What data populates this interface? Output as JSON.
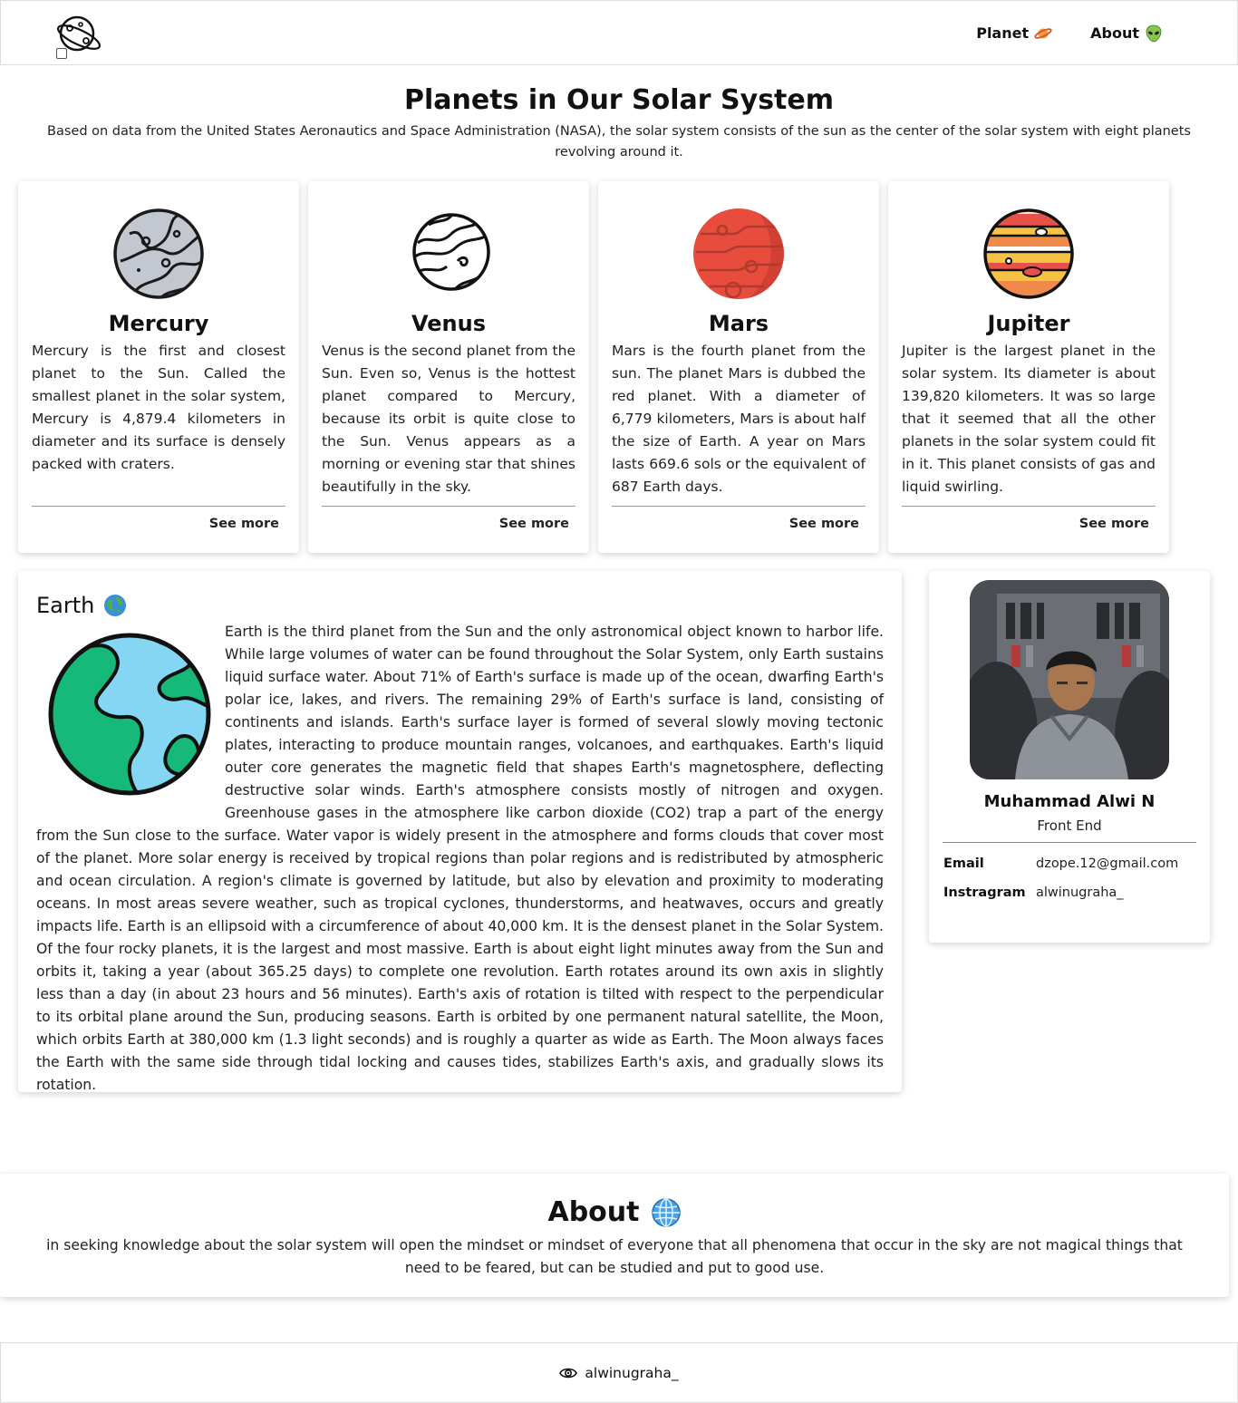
{
  "nav": {
    "logo_icon": "planet-logo-icon",
    "items": [
      {
        "label": "Planet",
        "icon": "saturn-icon"
      },
      {
        "label": "About",
        "icon": "alien-icon"
      }
    ]
  },
  "header": {
    "title": "Planets in Our Solar System",
    "subtitle": "Based on data from the United States Aeronautics and Space Administration (NASA), the solar system consists of the sun as the center of the solar system with eight planets revolving around it."
  },
  "planets": [
    {
      "name": "Mercury",
      "icon": "mercury-icon",
      "description": "Mercury is the first and closest planet to the Sun. Called the smallest planet in the solar system, Mercury is 4,879.4 kilometers in diameter and its surface is densely packed with craters.",
      "link": "See more"
    },
    {
      "name": "Venus",
      "icon": "venus-icon",
      "description": "Venus is the second planet from the Sun. Even so, Venus is the hottest planet compared to Mercury, because its orbit is quite close to the Sun. Venus appears as a morning or evening star that shines beautifully in the sky.",
      "link": "See more"
    },
    {
      "name": "Mars",
      "icon": "mars-icon",
      "description": "Mars is the fourth planet from the sun. The planet Mars is dubbed the red planet. With a diameter of 6,779 kilometers, Mars is about half the size of Earth. A year on Mars lasts 669.6 sols or the equivalent of 687 Earth days.",
      "link": "See more"
    },
    {
      "name": "Jupiter",
      "icon": "jupiter-icon",
      "description": "Jupiter is the largest planet in the solar system. Its diameter is about 139,820 kilometers. It was so large that it seemed that all the other planets in the solar system could fit in it. This planet consists of gas and liquid swirling.",
      "link": "See more"
    }
  ],
  "earth": {
    "title": "Earth",
    "title_icon": "globe-emoji-icon",
    "image_icon": "earth-icon",
    "text": "Earth is the third planet from the Sun and the only astronomical object known to harbor life. While large volumes of water can be found throughout the Solar System, only Earth sustains liquid surface water. About 71% of Earth's surface is made up of the ocean, dwarfing Earth's polar ice, lakes, and rivers. The remaining 29% of Earth's surface is land, consisting of continents and islands. Earth's surface layer is formed of several slowly moving tectonic plates, interacting to produce mountain ranges, volcanoes, and earthquakes. Earth's liquid outer core generates the magnetic field that shapes Earth's magnetosphere, deflecting destructive solar winds. Earth's atmosphere consists mostly of nitrogen and oxygen. Greenhouse gases in the atmosphere like carbon dioxide (CO2) trap a part of the energy from the Sun close to the surface. Water vapor is widely present in the atmosphere and forms clouds that cover most of the planet. More solar energy is received by tropical regions than polar regions and is redistributed by atmospheric and ocean circulation. A region's climate is governed by latitude, but also by elevation and proximity to moderating oceans. In most areas severe weather, such as tropical cyclones, thunderstorms, and heatwaves, occurs and greatly impacts life. Earth is an ellipsoid with a circumference of about 40,000 km. It is the densest planet in the Solar System. Of the four rocky planets, it is the largest and most massive. Earth is about eight light minutes away from the Sun and orbits it, taking a year (about 365.25 days) to complete one revolution. Earth rotates around its own axis in slightly less than a day (in about 23 hours and 56 minutes). Earth's axis of rotation is tilted with respect to the perpendicular to its orbital plane around the Sun, producing seasons. Earth is orbited by one permanent natural satellite, the Moon, which orbits Earth at 380,000 km (1.3 light seconds) and is roughly a quarter as wide as Earth. The Moon always faces the Earth with the same side through tidal locking and causes tides, stabilizes Earth's axis, and gradually slows its rotation."
  },
  "profile": {
    "photo": "profile-photo",
    "name": "Muhammad Alwi N",
    "role": "Front End",
    "email_label": "Email",
    "email": "dzope.12@gmail.com",
    "instagram_label": "Instragram",
    "instagram": "alwinugraha_"
  },
  "about": {
    "title": "About",
    "title_icon": "globe-meridians-icon",
    "text": "in seeking knowledge about the solar system will open the mindset or mindset of everyone that all phenomena that occur in the sky are not magical things that need to be feared, but can be studied and put to good use."
  },
  "footer": {
    "icon": "eye-icon",
    "text": "alwinugraha_"
  },
  "colors": {
    "mars": "#e74c3c",
    "earth_ocean": "#85d6f2",
    "earth_land": "#16b97a",
    "jupiter_band_a": "#f4a261",
    "jupiter_band_b": "#e63946"
  }
}
